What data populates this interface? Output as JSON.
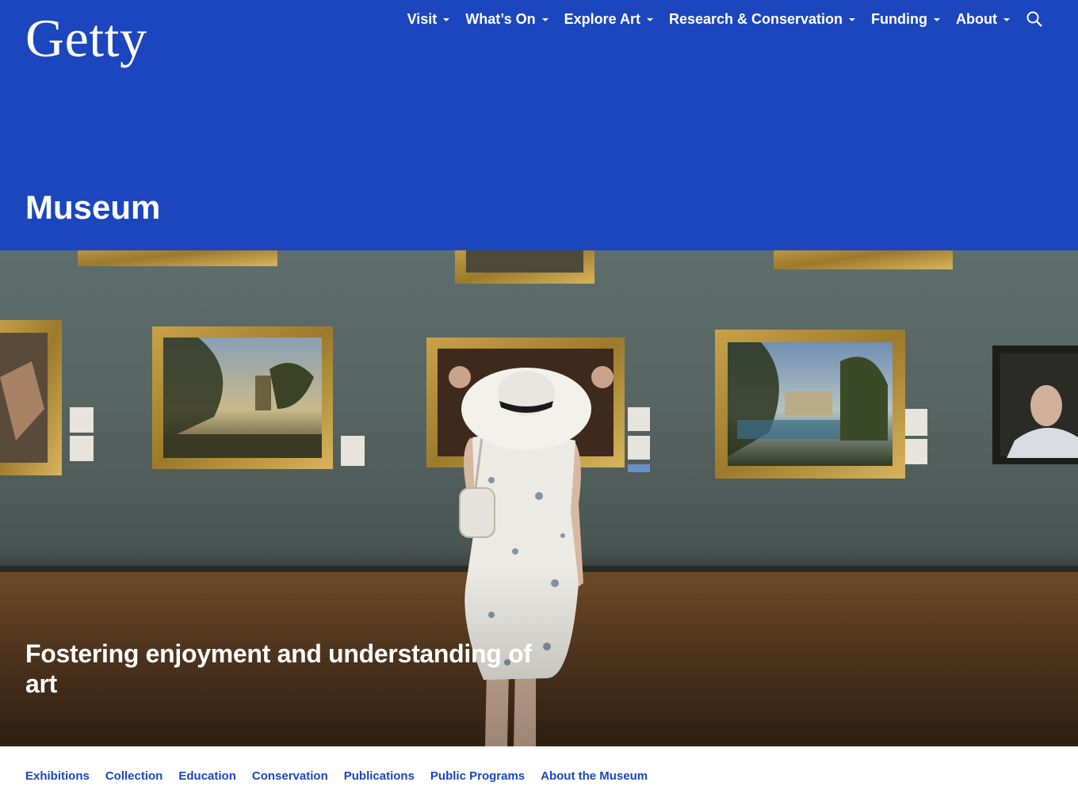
{
  "brand": {
    "logo_text": "Getty",
    "color": "#1c46bd"
  },
  "nav": {
    "items": [
      {
        "label": "Visit"
      },
      {
        "label": "What’s On"
      },
      {
        "label": "Explore Art"
      },
      {
        "label": "Research & Conservation"
      },
      {
        "label": "Funding"
      },
      {
        "label": "About"
      }
    ],
    "search_icon": "search-icon"
  },
  "page": {
    "title": "Museum"
  },
  "hero": {
    "tagline": "Fostering enjoyment and understanding of art"
  },
  "subnav": {
    "links": [
      {
        "label": "Exhibitions"
      },
      {
        "label": "Collection"
      },
      {
        "label": "Education"
      },
      {
        "label": "Conservation"
      },
      {
        "label": "Publications"
      },
      {
        "label": "Public Programs"
      },
      {
        "label": "About the Museum"
      }
    ]
  }
}
